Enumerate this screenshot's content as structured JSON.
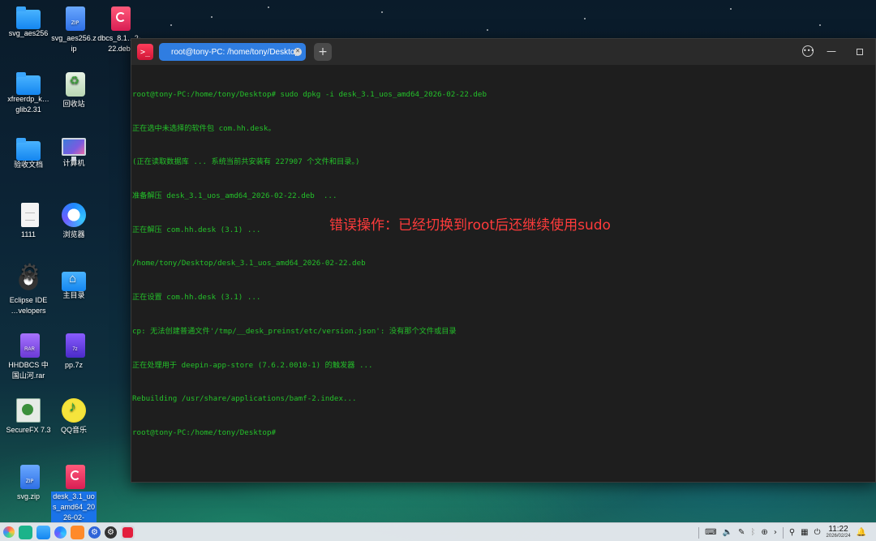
{
  "desktop": {
    "icons": [
      {
        "label": "svg_aes256",
        "type": "folder"
      },
      {
        "label": "svg_aes256.zip",
        "type": "zip"
      },
      {
        "label": "dbcs_8.1…2-22.deb",
        "type": "deb"
      },
      {
        "label": "xfreerdp_k…glib2.31",
        "type": "folder"
      },
      {
        "label": "回收站",
        "type": "trash"
      },
      {
        "label": "验收文档",
        "type": "folder"
      },
      {
        "label": "计算机",
        "type": "computer"
      },
      {
        "label": "1111",
        "type": "text"
      },
      {
        "label": "浏览器",
        "type": "browser"
      },
      {
        "label": "Eclipse IDE …velopers",
        "type": "eclipse"
      },
      {
        "label": "主目录",
        "type": "home"
      },
      {
        "label": "HHDBCS 中国山河.rar",
        "type": "rar"
      },
      {
        "label": "pp.7z",
        "type": "7z"
      },
      {
        "label": "SecureFX 7.3",
        "type": "securefx"
      },
      {
        "label": "QQ音乐",
        "type": "qqmusic"
      },
      {
        "label": "svg.zip",
        "type": "zip"
      },
      {
        "label": "desk_3.1_uos_amd64_2026-02-",
        "type": "deb"
      }
    ],
    "zip_badge": "ZIP",
    "rar_badge": "RAR",
    "sevenz_badge": "7z"
  },
  "terminal": {
    "app_icon": ">_",
    "tab_title": "root@tony-PC: /home/tony/Desktop",
    "new_tab": "+",
    "output_lines": [
      "root@tony-PC:/home/tony/Desktop# sudo dpkg -i desk_3.1_uos_amd64_2026-02-22.deb",
      "正在选中未选择的软件包 com.hh.desk。",
      "(正在读取数据库 ... 系统当前共安装有 227907 个文件和目录。)",
      "准备解压 desk_3.1_uos_amd64_2026-02-22.deb  ...",
      "正在解压 com.hh.desk (3.1) ...",
      "/home/tony/Desktop/desk_3.1_uos_amd64_2026-02-22.deb",
      "正在设置 com.hh.desk (3.1) ...",
      "cp: 无法创建普通文件'/tmp/__desk_preinst/etc/version.json': 没有那个文件或目录",
      "正在处理用于 deepin-app-store (7.6.2.0010-1) 的触发器 ...",
      "Rebuilding /usr/share/applications/bamf-2.index...",
      "root@tony-PC:/home/tony/Desktop#"
    ]
  },
  "annotation": "错误操作：已经切换到root后还继续使用sudo",
  "taskbar": {
    "time": "11:22",
    "date": "2026/02/24"
  },
  "colors": {
    "terminal_text": "#24c12a",
    "annotation": "#ff3b3b",
    "tab_active": "#2f7de1"
  }
}
